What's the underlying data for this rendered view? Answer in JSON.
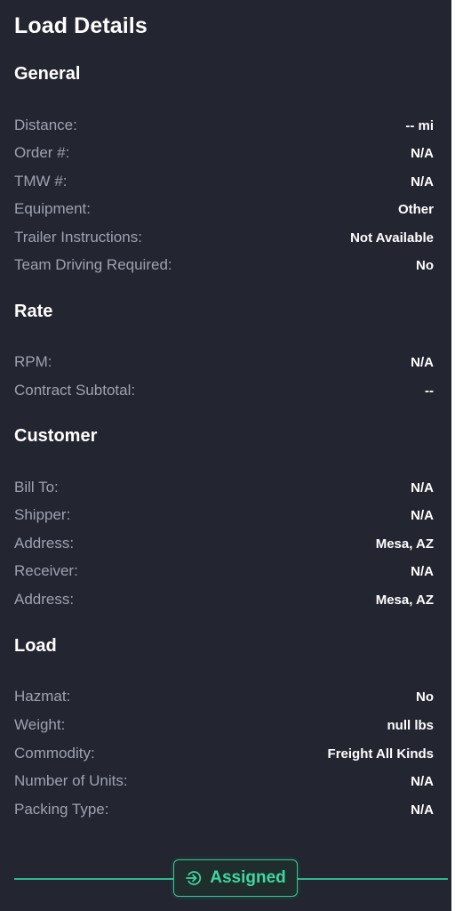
{
  "title": "Load Details",
  "sections": {
    "general": {
      "title": "General",
      "rows": [
        {
          "label": "Distance:",
          "value": "-- mi"
        },
        {
          "label": "Order #:",
          "value": "N/A"
        },
        {
          "label": "TMW #:",
          "value": "N/A"
        },
        {
          "label": "Equipment:",
          "value": "Other"
        },
        {
          "label": "Trailer Instructions:",
          "value": "Not Available"
        },
        {
          "label": "Team Driving Required:",
          "value": "No"
        }
      ]
    },
    "rate": {
      "title": "Rate",
      "rows": [
        {
          "label": "RPM:",
          "value": "N/A"
        },
        {
          "label": "Contract Subtotal:",
          "value": "--"
        }
      ]
    },
    "customer": {
      "title": "Customer",
      "rows": [
        {
          "label": "Bill To:",
          "value": "N/A"
        },
        {
          "label": "Shipper:",
          "value": "N/A"
        },
        {
          "label": "Address:",
          "value": "Mesa, AZ"
        },
        {
          "label": "Receiver:",
          "value": "N/A"
        },
        {
          "label": "Address:",
          "value": "Mesa, AZ"
        }
      ]
    },
    "load": {
      "title": "Load",
      "rows": [
        {
          "label": "Hazmat:",
          "value": "No"
        },
        {
          "label": "Weight:",
          "value": "null lbs"
        },
        {
          "label": "Commodity:",
          "value": "Freight All Kinds"
        },
        {
          "label": "Number of Units:",
          "value": "N/A"
        },
        {
          "label": "Packing Type:",
          "value": "N/A"
        }
      ]
    }
  },
  "status": {
    "label": "Assigned",
    "icon": "sign-in-icon",
    "color": "#3fd6a1"
  },
  "colors": {
    "background": "#232530",
    "label": "#9ea2b0",
    "value": "#ffffff",
    "accent": "#34c995"
  }
}
